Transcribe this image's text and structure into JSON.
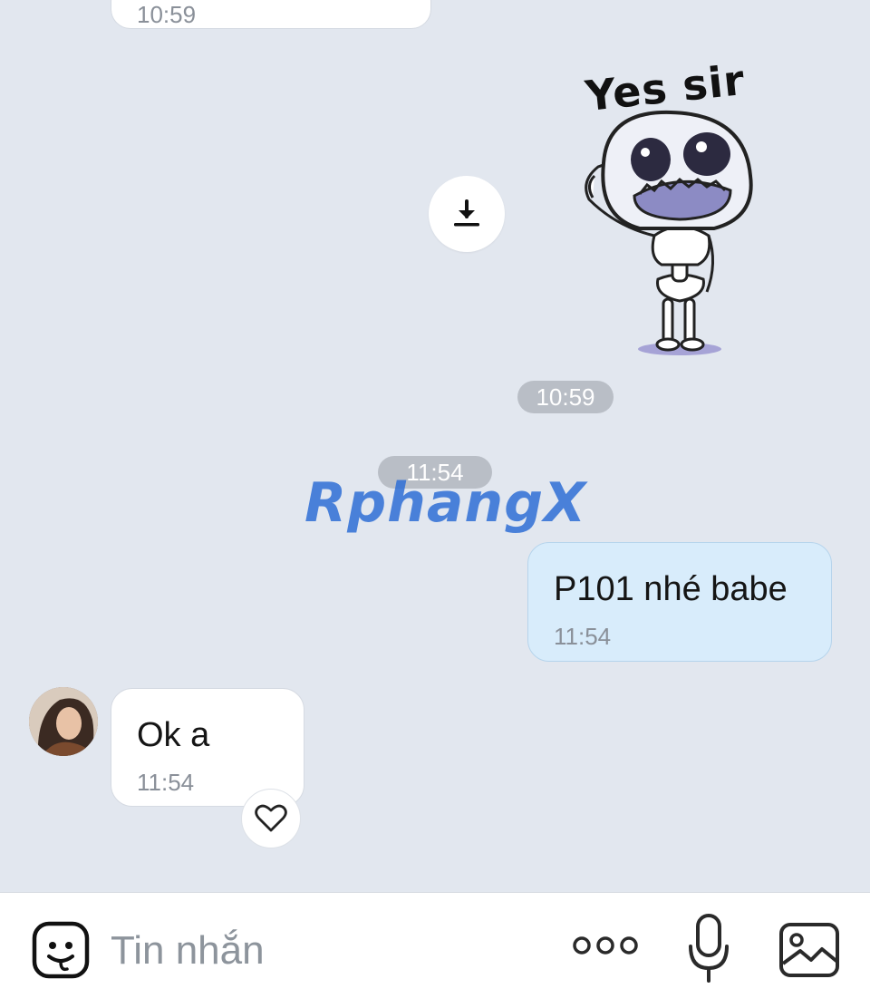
{
  "messages": {
    "previous_bubble_time": "10:59",
    "sticker": {
      "caption": "Yes sir",
      "time": "10:59",
      "download_icon": "download-icon"
    },
    "separator_time": "11:54",
    "watermark": "RphangX",
    "outgoing": {
      "text": "P101 nhé babe",
      "time": "11:54"
    },
    "incoming": {
      "text": "Ok a",
      "time": "11:54",
      "react_icon": "heart-outline-icon"
    }
  },
  "composer": {
    "placeholder": "Tin nhắn",
    "icons": [
      "sticker-face-icon",
      "more-dots-icon",
      "microphone-icon",
      "image-icon"
    ]
  },
  "colors": {
    "background": "#e2e7ef",
    "outgoing_bubble": "#d8ecfb",
    "incoming_bubble": "#ffffff",
    "time_pill": "#b9bec6"
  }
}
